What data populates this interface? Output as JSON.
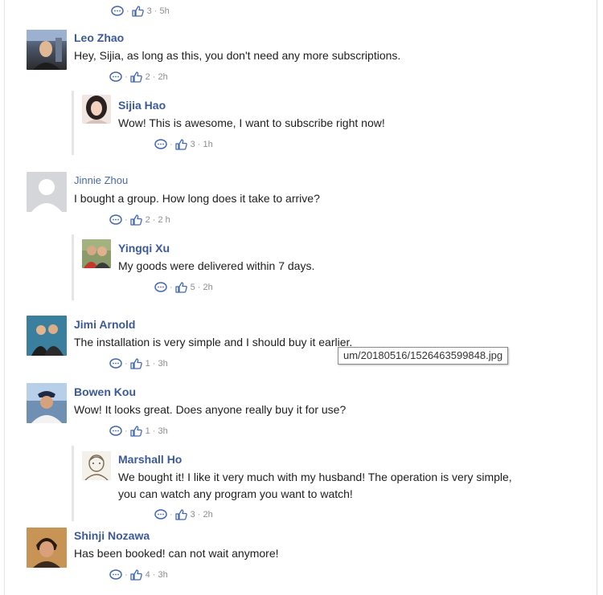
{
  "comments": [
    {
      "likes": "3",
      "time": "5h"
    },
    {
      "name": "Leo Zhao",
      "text": "Hey, Sijia, as long as this, you don't need any more subscriptions.",
      "likes": "2",
      "time": "2h"
    },
    {
      "name": "Sijia Hao",
      "text": "Wow! This is awesome, I want to subscribe right now!",
      "likes": "3",
      "time": "1h"
    },
    {
      "name": "Jinnie Zhou",
      "text": "I bought a group. How long does it take to arrive?",
      "likes": "2",
      "time": "2 h"
    },
    {
      "name": "Yingqi Xu",
      "text": "My goods were delivered within 7 days.",
      "likes": "5",
      "time": "2h"
    },
    {
      "name": "Jimi Arnold",
      "text": "The installation is very simple and I should buy it earlier.",
      "likes": "1",
      "time": "3h"
    },
    {
      "name": "Bowen Kou",
      "text": "Wow! It looks great. Does anyone really buy it for use?",
      "likes": "1",
      "time": "3h"
    },
    {
      "name": "Marshall Ho",
      "text_line1": "We bought it! I like it very much with my husband! The operation is very simple,",
      "text_line2": "you can watch any program you want to watch!",
      "likes": "3",
      "time": "2h"
    },
    {
      "name": "Shinji Nozawa",
      "text": "Has been booked! can not wait anymore!",
      "likes": "4",
      "time": "3h"
    }
  ],
  "tooltip": {
    "text": "um/20180516/1526463599848.jpg"
  },
  "meta_separator": "·",
  "icons": {
    "comment": "comment-bubble-icon",
    "like": "thumbs-up-icon"
  },
  "colors": {
    "name": "#3b5998",
    "text": "#1d1d1d",
    "meta": "#8a8d91",
    "icon": "#4267b2"
  }
}
